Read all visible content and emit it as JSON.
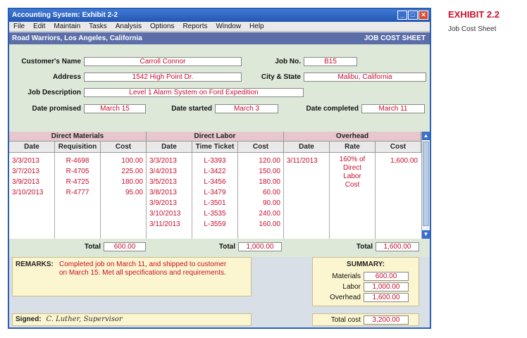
{
  "exhibit": {
    "title": "EXHIBIT 2.2",
    "subtitle": "Job Cost Sheet"
  },
  "window": {
    "title": "Accounting System: Exhibit 2-2"
  },
  "menu": [
    "File",
    "Edit",
    "Maintain",
    "Tasks",
    "Analysis",
    "Options",
    "Reports",
    "Window",
    "Help"
  ],
  "infobar": {
    "company": "Road Warriors, Los Angeles, California",
    "sheet": "JOB COST SHEET"
  },
  "form": {
    "customer_label": "Customer's Name",
    "customer": "Carroll Connor",
    "job_label": "Job No.",
    "job_no": "B15",
    "address_label": "Address",
    "address": "1542 High Point Dr.",
    "city_label": "City & State",
    "city": "Malibu, California",
    "desc_label": "Job Description",
    "description": "Level 1 Alarm System on Ford Expedition",
    "promised_label": "Date promised",
    "promised": "March 15",
    "started_label": "Date started",
    "started": "March 3",
    "completed_label": "Date completed",
    "completed": "March 11"
  },
  "table": {
    "groups": [
      "Direct Materials",
      "Direct Labor",
      "Overhead"
    ],
    "columns": [
      "Date",
      "Requisition",
      "Cost",
      "Date",
      "Time Ticket",
      "Cost",
      "Date",
      "Rate",
      "Cost"
    ],
    "materials": [
      [
        "3/3/2013",
        "R-4698",
        "100.00"
      ],
      [
        "3/7/2013",
        "R-4705",
        "225.00"
      ],
      [
        "3/9/2013",
        "R-4725",
        "180.00"
      ],
      [
        "3/10/2013",
        "R-4777",
        "95.00"
      ]
    ],
    "labor": [
      [
        "3/3/2013",
        "L-3393",
        "120.00"
      ],
      [
        "3/4/2013",
        "L-3422",
        "150.00"
      ],
      [
        "3/5/2013",
        "L-3456",
        "180.00"
      ],
      [
        "3/8/2013",
        "L-3479",
        "60.00"
      ],
      [
        "3/9/2013",
        "L-3501",
        "90.00"
      ],
      [
        "3/10/2013",
        "L-3535",
        "240.00"
      ],
      [
        "3/11/2013",
        "L-3559",
        "160.00"
      ]
    ],
    "overhead": {
      "date": "3/11/2013",
      "rate_lines": [
        "160% of",
        "Direct",
        "Labor",
        "Cost"
      ],
      "cost": "1,600.00"
    }
  },
  "totals": {
    "label": "Total",
    "materials": "600.00",
    "labor": "1,000.00",
    "overhead": "1,600.00"
  },
  "remarks": {
    "label": "REMARKS:",
    "line1": "Completed job on March 11, and shipped to customer",
    "line2": "on March 15. Met all specifications and requirements."
  },
  "summary": {
    "title": "SUMMARY:",
    "materials_label": "Materials",
    "materials": "600.00",
    "labor_label": "Labor",
    "labor": "1,000.00",
    "overhead_label": "Overhead",
    "overhead": "1,600.00",
    "total_label": "Total cost",
    "total": "3,200.00"
  },
  "signed": {
    "label": "Signed:",
    "signature": "C. Luther, Supervisor"
  }
}
